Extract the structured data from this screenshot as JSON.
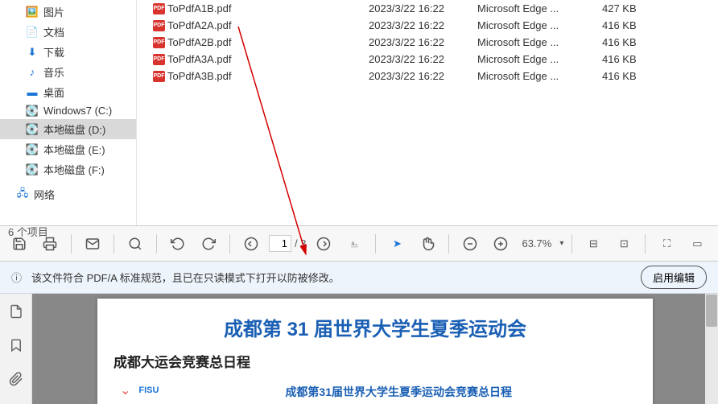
{
  "sidebar": {
    "items": [
      {
        "label": "图片",
        "icon": "image-icon"
      },
      {
        "label": "文档",
        "icon": "document-icon"
      },
      {
        "label": "下载",
        "icon": "download-icon"
      },
      {
        "label": "音乐",
        "icon": "music-icon"
      },
      {
        "label": "桌面",
        "icon": "desktop-icon"
      },
      {
        "label": "Windows7 (C:)",
        "icon": "drive-icon"
      },
      {
        "label": "本地磁盘 (D:)",
        "icon": "drive-icon",
        "selected": true
      },
      {
        "label": "本地磁盘 (E:)",
        "icon": "drive-icon"
      },
      {
        "label": "本地磁盘 (F:)",
        "icon": "drive-icon"
      }
    ],
    "network": "网络",
    "status": "6 个项目"
  },
  "files": [
    {
      "name": "ToPdfA1B.pdf",
      "date": "2023/3/22 16:22",
      "type": "Microsoft Edge ...",
      "size": "427 KB"
    },
    {
      "name": "ToPdfA2A.pdf",
      "date": "2023/3/22 16:22",
      "type": "Microsoft Edge ...",
      "size": "416 KB"
    },
    {
      "name": "ToPdfA2B.pdf",
      "date": "2023/3/22 16:22",
      "type": "Microsoft Edge ...",
      "size": "416 KB"
    },
    {
      "name": "ToPdfA3A.pdf",
      "date": "2023/3/22 16:22",
      "type": "Microsoft Edge ...",
      "size": "416 KB"
    },
    {
      "name": "ToPdfA3B.pdf",
      "date": "2023/3/22 16:22",
      "type": "Microsoft Edge ...",
      "size": "416 KB"
    }
  ],
  "toolbar": {
    "page_current": "1",
    "page_sep": "/ 3",
    "zoom": "63.7%"
  },
  "infobar": {
    "message": "该文件符合 PDF/A 标准规范，且已在只读模式下打开以防被修改。",
    "edit": "启用编辑"
  },
  "doc": {
    "title": "成都第 31 届世界大学生夏季运动会",
    "sub1": "成都大运会竞赛总日程",
    "sub2": "成都第31届世界大学生夏季运动会竞赛总日程",
    "logo1": "⌄",
    "logo2": "FISU"
  }
}
